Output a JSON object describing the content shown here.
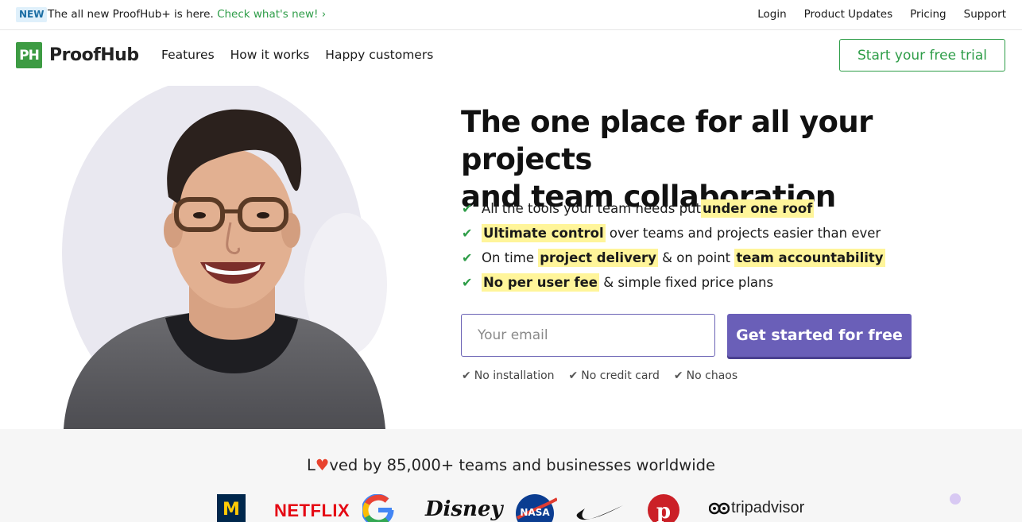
{
  "announcement": {
    "badge": "NEW",
    "text": "The all new ProofHub+ is here.",
    "link": "Check what's new! ›"
  },
  "top_links": [
    "Login",
    "Product Updates",
    "Pricing",
    "Support"
  ],
  "logo": {
    "mark": "PH",
    "name": "ProofHub"
  },
  "nav": [
    "Features",
    "How it works",
    "Happy customers"
  ],
  "trial_button": "Start your free trial",
  "hero": {
    "headline_line1": "The one place for all your projects",
    "headline_line2": "and team collaboration",
    "features": [
      {
        "pre": "All the tools your team needs put ",
        "hl": "under one roof",
        "post": ""
      },
      {
        "pre": "",
        "hl": "Ultimate control",
        "post": " over teams and projects easier than ever"
      },
      {
        "pre": "On time ",
        "hl": "project delivery",
        "mid": " & on point ",
        "hl2": "team accountability"
      },
      {
        "pre": "",
        "hl": "No per user fee",
        "post": " & simple fixed price plans"
      }
    ],
    "email_placeholder": "Your email",
    "cta": "Get started for free",
    "perks": [
      "No installation",
      "No credit card",
      "No chaos"
    ]
  },
  "customers": {
    "loved_pre": "L",
    "loved_post": "ved by 85,000+ teams and businesses worldwide",
    "logos": [
      "michigan-logo",
      "NETFLIX",
      "google-logo",
      "Disney",
      "NASA",
      "nike-logo",
      "pinterest-logo",
      "tripadvisor"
    ]
  },
  "colors": {
    "brand_green": "#3d9b43",
    "cta_purple": "#6a5fb8",
    "highlight": "#fff59a"
  }
}
